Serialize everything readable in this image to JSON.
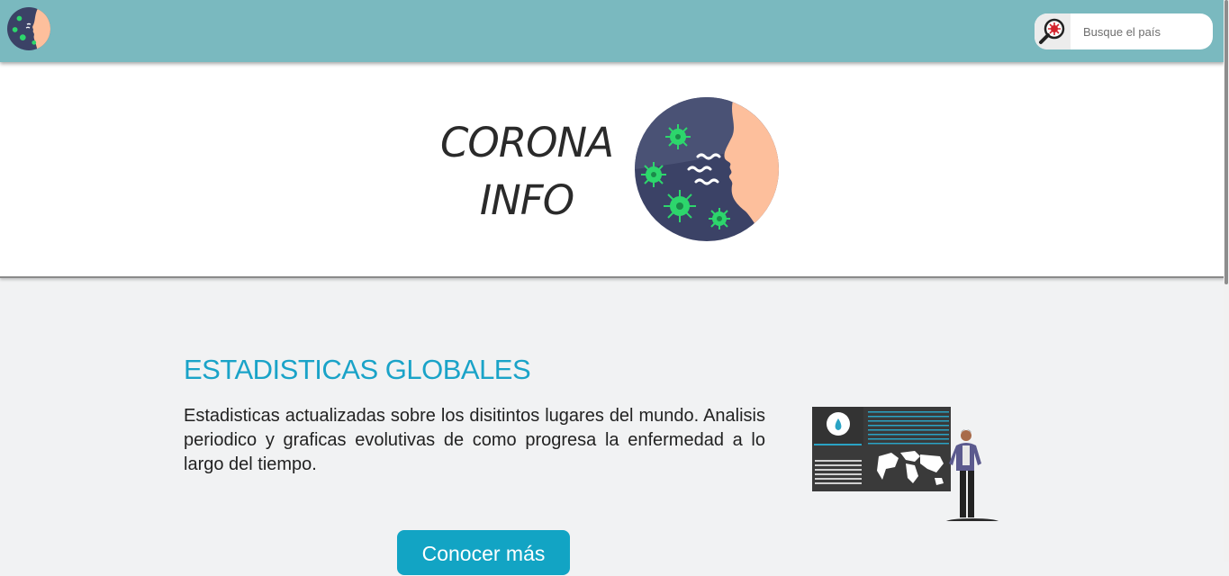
{
  "navbar": {
    "logo_icon": "corona-face-icon",
    "search": {
      "icon": "virus-magnifier-icon",
      "placeholder": "Busque el país",
      "value": ""
    }
  },
  "hero": {
    "title_line1": "CORONA",
    "title_line2": "INFO",
    "logo_icon": "corona-face-icon"
  },
  "section": {
    "title": "ESTADISTICAS GLOBALES",
    "description": "Estadisticas actualizadas sobre los disitintos lugares del mundo. Analisis periodico y graficas evolutivas de como progresa la enfermedad a lo largo del tiempo.",
    "illustration": "dashboard-person-illustration",
    "button_label": "Conocer más"
  },
  "colors": {
    "navbar": "#7ab9bf",
    "accent": "#1aa3c8",
    "button": "#12a4c4",
    "face_skin": "#fdbf9c",
    "face_bg": "#3b4266",
    "virus": "#2dd66c"
  }
}
